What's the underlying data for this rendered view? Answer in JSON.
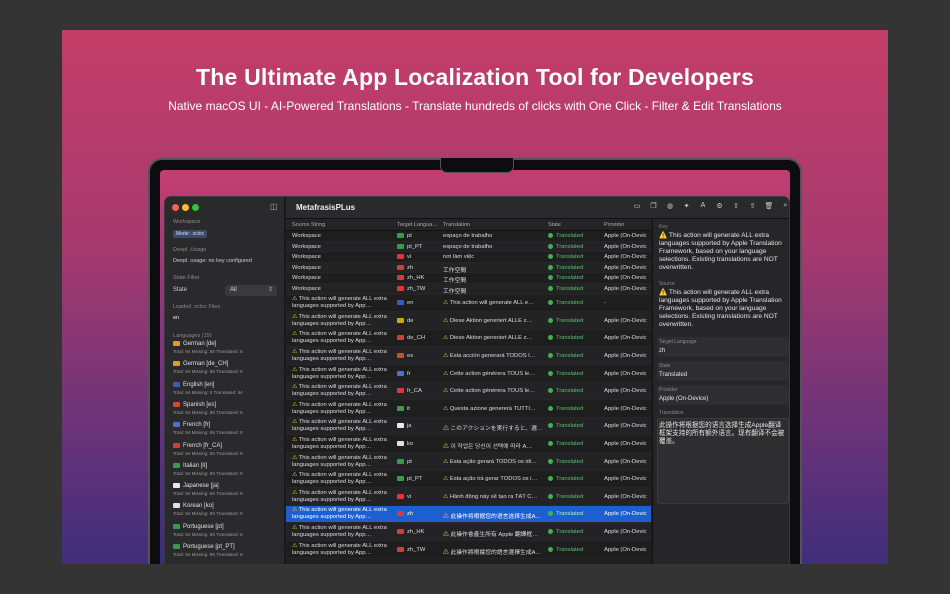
{
  "headline": "The Ultimate App Localization Tool for Developers",
  "subline": "Native macOS UI - AI-Powered Translations - Translate hundreds of clicks with One Click - Filter & Edit Translations",
  "app": {
    "title": "MetafrasisPLus"
  },
  "sidebar": {
    "workspace_label": "Workspace",
    "mode_badge": "Mode: .xcloc",
    "deepl_label": "Deepl. Usage",
    "deepl_value": "Deepl. usage: no key configured",
    "state_filter_label": "State Filter",
    "state_label": "State",
    "state_value": "All",
    "loaded_label": "Loaded .xcloc Files",
    "loaded_value": "en",
    "languages_label": "Languages (15)",
    "languages": [
      {
        "name": "German [de]",
        "stats": "Total: 94   Missing: 86   Translated: 8",
        "color": "#d9a21b"
      },
      {
        "name": "German [de_CH]",
        "stats": "Total: 94   Missing: 86   Translated: 8",
        "color": "#d9a21b"
      },
      {
        "name": "English [en]",
        "stats": "Total: 94   Missing: 0   Translated: 94",
        "color": "#3b5bb8"
      },
      {
        "name": "Spanish [es]",
        "stats": "Total: 94   Missing: 86   Translated: 8",
        "color": "#d14b2a"
      },
      {
        "name": "French [fr]",
        "stats": "Total: 94   Missing: 86   Translated: 8",
        "color": "#4f6fd0"
      },
      {
        "name": "French [fr_CA]",
        "stats": "Total: 94   Missing: 86   Translated: 8",
        "color": "#d83a3a"
      },
      {
        "name": "Italian [it]",
        "stats": "Total: 94   Missing: 86   Translated: 8",
        "color": "#3e9a4a"
      },
      {
        "name": "Japanese [ja]",
        "stats": "Total: 94   Missing: 86   Translated: 8",
        "color": "#e8e8e8"
      },
      {
        "name": "Korean [ko]",
        "stats": "Total: 94   Missing: 86   Translated: 8",
        "color": "#e0e0e0"
      },
      {
        "name": "Portuguese [pt]",
        "stats": "Total: 94   Missing: 86   Translated: 8",
        "color": "#3a9a48"
      },
      {
        "name": "Portuguese [pt_PT]",
        "stats": "Total: 94   Missing: 86   Translated: 8",
        "color": "#3a9a48"
      }
    ]
  },
  "table": {
    "headers": {
      "source": "Source String",
      "target": "Target Langua…",
      "translation": "Translation",
      "state": "State",
      "provider": "Provider"
    },
    "rows": [
      {
        "src": "Workspace",
        "lang": "pt",
        "tr": "espaço de trabalho",
        "st": "Translated",
        "pv": "Apple (On-Devic",
        "color": "#3a9a48"
      },
      {
        "src": "Workspace",
        "lang": "pt_PT",
        "tr": "espaço de trabalho",
        "st": "Translated",
        "pv": "Apple (On-Devic",
        "color": "#3a9a48"
      },
      {
        "src": "Workspace",
        "lang": "vi",
        "tr": "nơi làm việc",
        "st": "Translated",
        "pv": "Apple (On-Devic",
        "color": "#d83a3a"
      },
      {
        "src": "Workspace",
        "lang": "zh",
        "tr": "工作空間",
        "st": "Translated",
        "pv": "Apple (On-Devic",
        "color": "#d83a3a"
      },
      {
        "src": "Workspace",
        "lang": "zh_HK",
        "tr": "工作空間",
        "st": "Translated",
        "pv": "Apple (On-Devic",
        "color": "#d83a3a"
      },
      {
        "src": "Workspace",
        "lang": "zh_TW",
        "tr": "工作空間",
        "st": "Translated",
        "pv": "Apple (On-Devic",
        "color": "#d83a3a"
      },
      {
        "src": "This action will generate ALL extra languages supported by App…",
        "lang": "en",
        "tr": "This action will generate ALL e…",
        "st": "Translated",
        "pv": "-",
        "color": "#3b5bb8",
        "warn": "1"
      },
      {
        "src": "This action will generate ALL extra languages supported by App…",
        "lang": "de",
        "tr": "Diese Aktion generiert ALLE z…",
        "st": "Translated",
        "pv": "Apple (On-Devic",
        "color": "#d9a21b",
        "warn": "1"
      },
      {
        "src": "This action will generate ALL extra languages supported by App…",
        "lang": "de_CH",
        "tr": "Diese Aktion generiert ALLE z…",
        "st": "Translated",
        "pv": "Apple (On-Devic",
        "color": "#d83a3a",
        "warn": "1"
      },
      {
        "src": "This action will generate ALL extra languages supported by App…",
        "lang": "es",
        "tr": "Esta acción generará TODOS l…",
        "st": "Translated",
        "pv": "Apple (On-Devic",
        "color": "#d14b2a",
        "warn": "1"
      },
      {
        "src": "This action will generate ALL extra languages supported by App…",
        "lang": "fr",
        "tr": "Cette action générera TOUS le…",
        "st": "Translated",
        "pv": "Apple (On-Devic",
        "color": "#4f6fd0",
        "warn": "1"
      },
      {
        "src": "This action will generate ALL extra languages supported by App…",
        "lang": "fr_CA",
        "tr": "Cette action générera TOUS le…",
        "st": "Translated",
        "pv": "Apple (On-Devic",
        "color": "#d83a3a",
        "warn": "1"
      },
      {
        "src": "This action will generate ALL extra languages supported by App…",
        "lang": "it",
        "tr": "Questa azione genererà TUTTI…",
        "st": "Translated",
        "pv": "Apple (On-Devic",
        "color": "#3e9a4a",
        "warn": "1"
      },
      {
        "src": "This action will generate ALL extra languages supported by App…",
        "lang": "ja",
        "tr": "このアクションを実行すると、選…",
        "st": "Translated",
        "pv": "Apple (On-Devic",
        "color": "#e8e8e8",
        "warn": "1"
      },
      {
        "src": "This action will generate ALL extra languages supported by App…",
        "lang": "ko",
        "tr": "이 작업은 당신이 선택에 따라 A…",
        "st": "Translated",
        "pv": "Apple (On-Devic",
        "color": "#e0e0e0",
        "warn": "1"
      },
      {
        "src": "This action will generate ALL extra languages supported by App…",
        "lang": "pt",
        "tr": "Esta ação gerará TODOS os idi…",
        "st": "Translated",
        "pv": "Apple (On-Devic",
        "color": "#3a9a48",
        "warn": "1"
      },
      {
        "src": "This action will generate ALL extra languages supported by App…",
        "lang": "pt_PT",
        "tr": "Esta ação irá gerar TODOS os i…",
        "st": "Translated",
        "pv": "Apple (On-Devic",
        "color": "#3a9a48",
        "warn": "1"
      },
      {
        "src": "This action will generate ALL extra languages supported by App…",
        "lang": "vi",
        "tr": "Hành động này sẽ tạo ra TẤT C…",
        "st": "Translated",
        "pv": "Apple (On-Devic",
        "color": "#d83a3a",
        "warn": "1"
      },
      {
        "src": "This action will generate ALL extra languages supported by App…",
        "lang": "zh",
        "tr": "此操作将根据您的语言选择生成A…",
        "st": "Translated",
        "pv": "Apple (On-Devic",
        "color": "#d83a3a",
        "warn": "1",
        "selected": "1"
      },
      {
        "src": "This action will generate ALL extra languages supported by App…",
        "lang": "zh_HK",
        "tr": "此操作會產生所有 Apple 翻譯框…",
        "st": "Translated",
        "pv": "Apple (On-Devic",
        "color": "#d83a3a",
        "warn": "1"
      },
      {
        "src": "This action will generate ALL extra languages supported by App…",
        "lang": "zh_TW",
        "tr": "此操作將根據您的語言選擇生成A…",
        "st": "Translated",
        "pv": "Apple (On-Devic",
        "color": "#d83a3a",
        "warn": "1"
      }
    ]
  },
  "detail": {
    "key_label": "Key",
    "key_value": "⚠️ This action will generate ALL extra languages supported by Apple Translation Framework, based on your language selections. Existing translations are NOT overwritten.",
    "source_label": "Source",
    "source_value": "⚠️ This action will generate ALL extra languages supported by Apple Translation Framework, based on your language selections. Existing translations are NOT overwritten.",
    "target_label": "Target Language",
    "target_value": "zh",
    "state_label": "State",
    "state_value": "Translated",
    "provider_label": "Provider",
    "provider_value": "Apple (On-Device)",
    "translation_label": "Translation",
    "translation_value": "此操作将根据您的语言选择生成Apple翻译框架支持的所有额外语言。现有翻译不会被覆盖。"
  },
  "toolbar_icons": [
    "folder-icon",
    "doc-icon",
    "globe-icon",
    "sparkle-icon",
    "text-format-icon",
    "gear-icon",
    "share-icon",
    "export-icon",
    "trash-icon",
    "search-icon"
  ],
  "toolbar_glyphs": [
    "▭",
    "❐",
    "◍",
    "✦",
    "A",
    "⚙",
    "⇧",
    "⇪",
    "🗑",
    "⌕"
  ]
}
